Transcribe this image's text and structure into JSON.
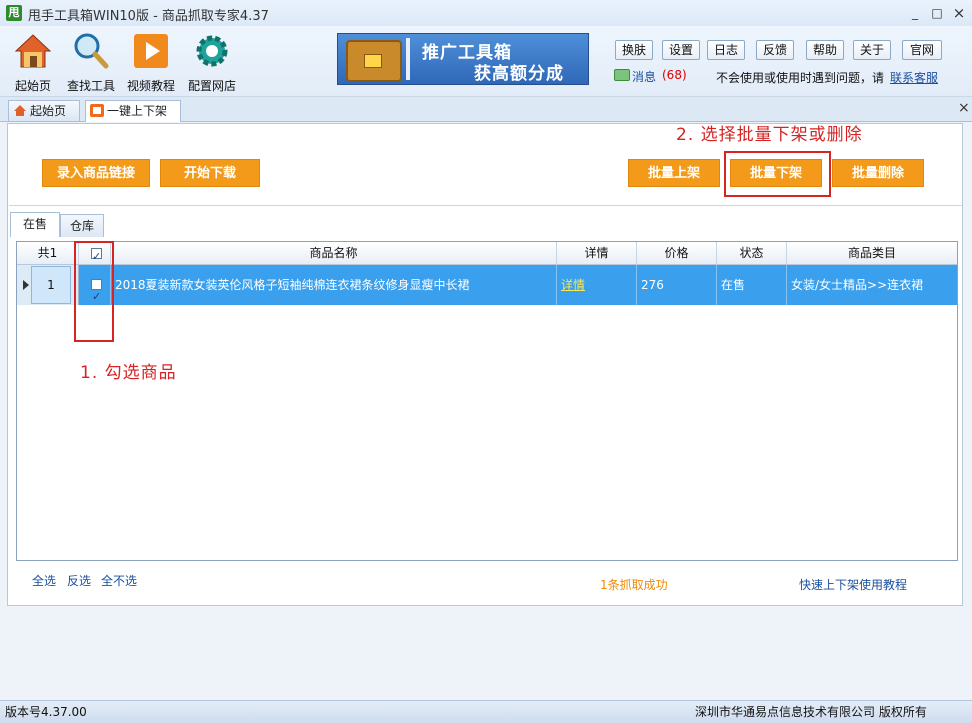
{
  "window": {
    "app_icon_text": "甩",
    "title": "甩手工具箱WIN10版 - 商品抓取专家4.37",
    "minimize": "_",
    "maximize": "□",
    "close": "×"
  },
  "toolbar": {
    "items": [
      {
        "label": "起始页",
        "icon": "home-icon"
      },
      {
        "label": "查找工具",
        "icon": "magnifier-icon"
      },
      {
        "label": "视频教程",
        "icon": "play-icon"
      },
      {
        "label": "配置网店",
        "icon": "gear-icon"
      }
    ],
    "banner": {
      "line1": "推广工具箱",
      "line2": "获高额分成"
    },
    "buttons": [
      "换肤",
      "设置",
      "日志",
      "反馈",
      "帮助",
      "关于",
      "官网"
    ],
    "messages_label": "消息",
    "messages_count": "(68)",
    "help_text": "不会使用或使用时遇到问题，请",
    "help_link": "联系客服"
  },
  "tabs": [
    {
      "label": "起始页",
      "icon": "home-icon"
    },
    {
      "label": "一键上下架",
      "icon": "tool-icon",
      "active": true
    }
  ],
  "tab_close_all": "×",
  "actions": {
    "import_links": "录入商品链接",
    "start_download": "开始下载",
    "batch_list": "批量上架",
    "batch_delist": "批量下架",
    "batch_delete": "批量删除"
  },
  "annotations": {
    "step1": "1. 勾选商品",
    "step2": "2. 选择批量下架或删除"
  },
  "subtabs": [
    "在售",
    "仓库"
  ],
  "grid": {
    "count_header": "共1",
    "headers": [
      "商品名称",
      "详情",
      "价格",
      "状态",
      "商品类目"
    ],
    "rows": [
      {
        "num": "1",
        "checked": true,
        "name": "2018夏装新款女装英伦风格子短袖纯棉连衣裙条纹修身显瘦中长裙",
        "detail": "详情",
        "price": "276",
        "status": "在售",
        "category": "女装/女士精品>>连衣裙"
      }
    ]
  },
  "selection": {
    "all": "全选",
    "invert": "反选",
    "none": "全不选"
  },
  "fetch_status": "1条抓取成功",
  "tutorial_link": "快速上下架使用教程",
  "statusbar": {
    "version": "版本号4.37.00",
    "copyright": "深圳市华通易点信息技术有限公司 版权所有"
  },
  "colors": {
    "accent_orange": "#f39a1a",
    "selection_blue": "#3aa0ee",
    "annotation_red": "#d62424"
  }
}
